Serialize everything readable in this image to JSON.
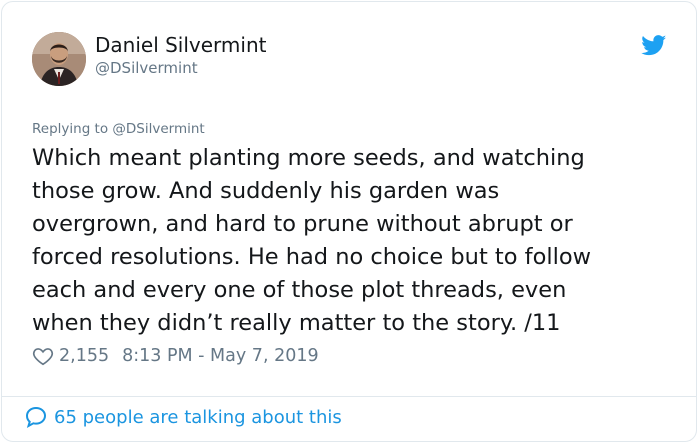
{
  "author": {
    "name": "Daniel Silvermint",
    "handle": "@DSilvermint"
  },
  "reply": {
    "text": "Replying to @DSilvermint"
  },
  "tweet": {
    "lines": [
      "Which meant planting more seeds, and watching",
      "those grow. And suddenly his garden was",
      "overgrown, and hard to prune without abrupt or",
      "forced resolutions. He had no choice but to follow",
      "each and every one of those plot threads, even",
      "when they didn’t really matter to the story.  /11"
    ]
  },
  "meta": {
    "likes": "2,155",
    "timestamp": "8:13 PM - May 7, 2019"
  },
  "footer": {
    "talking": "65 people are talking about this"
  },
  "icons": {
    "bird": "twitter-bird-icon",
    "heart": "heart-outline-icon",
    "bubble": "speech-bubble-icon"
  },
  "colors": {
    "brand": "#1da1f2",
    "link": "#1b95e0",
    "secondary_text": "#657786",
    "primary_text": "#14171a"
  }
}
